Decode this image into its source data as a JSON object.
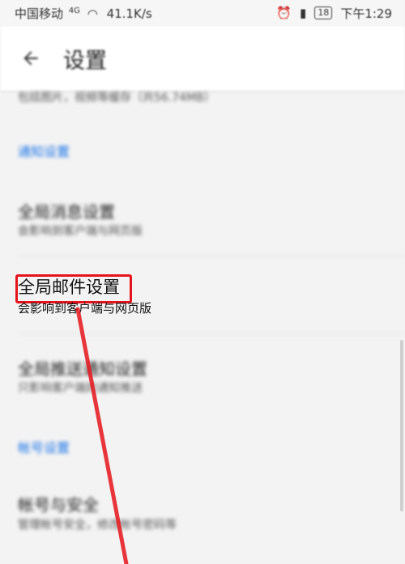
{
  "status_bar": {
    "carrier": "中国移动",
    "network": "4G",
    "speed": "41.1K/s",
    "battery": "18",
    "time": "下午1:29"
  },
  "app_bar": {
    "back_icon": "arrow-left-icon",
    "title": "设置"
  },
  "content": {
    "top_desc": "包括图片，视频等缓存（共56.74MB）",
    "sections": [
      {
        "header": "通知设置",
        "items": [
          {
            "title": "全局消息设置",
            "subtitle": "会影响到客户端与网页版"
          },
          {
            "title": "全局邮件设置",
            "subtitle": "会影响到客户端与网页版",
            "highlighted": true
          },
          {
            "title": "全局推送通知设置",
            "subtitle": "只影响客户端的通知推送"
          }
        ]
      },
      {
        "header": "帐号设置",
        "items": [
          {
            "title": "帐号与安全",
            "subtitle": "管理帐号安全，修改帐号密码等"
          }
        ]
      }
    ]
  },
  "annotation": {
    "highlight_color": "#e5141c",
    "arrow_color": "#e5141c"
  }
}
